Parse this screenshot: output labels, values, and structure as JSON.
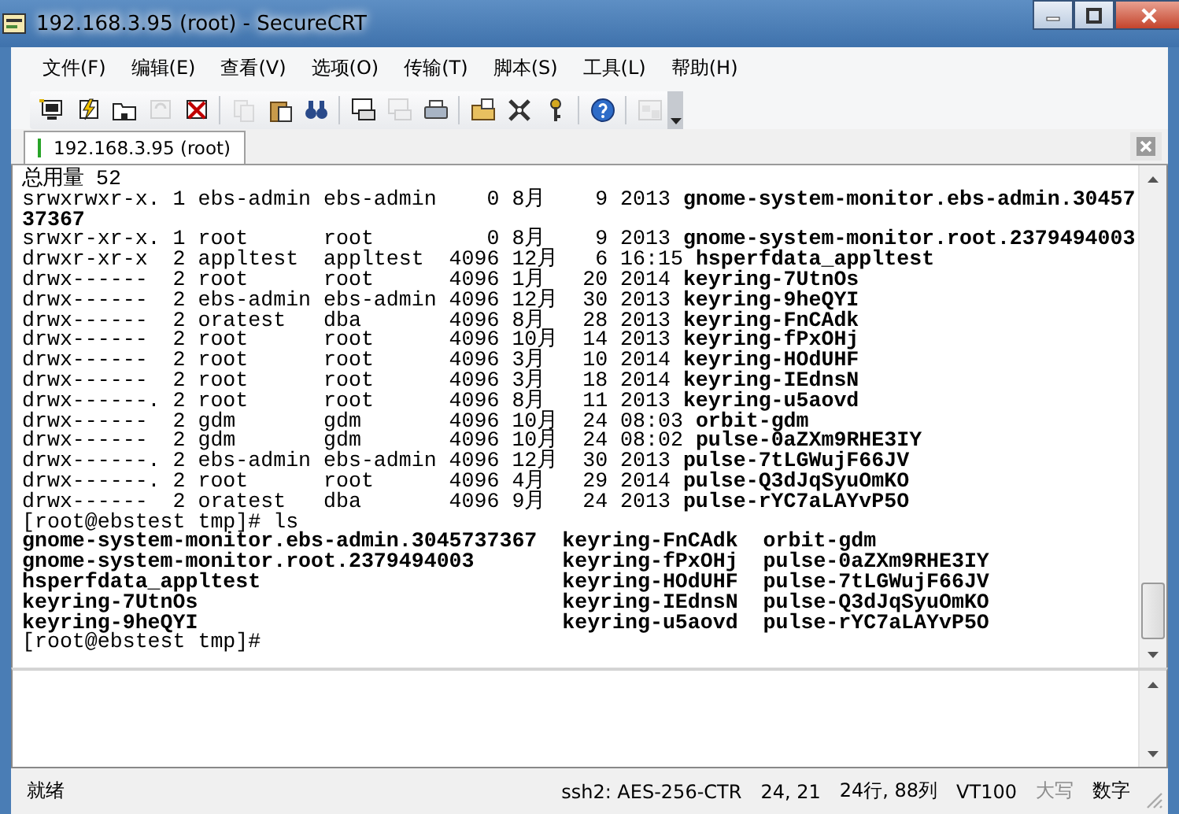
{
  "window": {
    "title": "192.168.3.95 (root) - SecureCRT"
  },
  "menu": [
    "文件(F)",
    "编辑(E)",
    "查看(V)",
    "选项(O)",
    "传输(T)",
    "脚本(S)",
    "工具(L)",
    "帮助(H)"
  ],
  "toolbar": [
    {
      "kind": "connect",
      "disabled": false
    },
    {
      "kind": "quick",
      "disabled": false
    },
    {
      "kind": "folder",
      "disabled": false
    },
    {
      "kind": "reconnect",
      "disabled": true
    },
    {
      "kind": "disconnect",
      "disabled": false
    },
    {
      "kind": "separator"
    },
    {
      "kind": "copy",
      "disabled": true
    },
    {
      "kind": "paste",
      "disabled": false
    },
    {
      "kind": "find",
      "disabled": false
    },
    {
      "kind": "separator"
    },
    {
      "kind": "printscreen",
      "disabled": false
    },
    {
      "kind": "printsel",
      "disabled": true
    },
    {
      "kind": "print",
      "disabled": false
    },
    {
      "kind": "separator"
    },
    {
      "kind": "options",
      "disabled": false
    },
    {
      "kind": "mapkeys",
      "disabled": false
    },
    {
      "kind": "key",
      "disabled": false
    },
    {
      "kind": "separator"
    },
    {
      "kind": "help",
      "disabled": false
    },
    {
      "kind": "separator"
    },
    {
      "kind": "window",
      "disabled": true
    }
  ],
  "tabs": [
    {
      "label": "192.168.3.95 (root)",
      "selected": true
    }
  ],
  "terminal": {
    "lines": [
      {
        "text": "总用量 52",
        "bold": false
      },
      {
        "text": "srwxrwxr-x. 1 ebs-admin ebs-admin    0 8月    9 2013 **gnome-system-monitor.ebs-admin.30457**",
        "bold": false
      },
      {
        "text": "37367",
        "bold": true
      },
      {
        "text": "srwxr-xr-x. 1 root      root         0 8月    9 2013 **gnome-system-monitor.root.2379494003**",
        "bold": false
      },
      {
        "text": "drwxr-xr-x  2 appltest  appltest  4096 12月   6 16:15 **hsperfdata_appltest**",
        "bold": false
      },
      {
        "text": "drwx------  2 root      root      4096 1月   20 2014 **keyring-7UtnOs**",
        "bold": false
      },
      {
        "text": "drwx------  2 ebs-admin ebs-admin 4096 12月  30 2013 **keyring-9heQYI**",
        "bold": false
      },
      {
        "text": "drwx------  2 oratest   dba       4096 8月   28 2013 **keyring-FnCAdk**",
        "bold": false
      },
      {
        "text": "drwx------  2 root      root      4096 10月  14 2013 **keyring-fPxOHj**",
        "bold": false
      },
      {
        "text": "drwx------  2 root      root      4096 3月   10 2014 **keyring-HOdUHF**",
        "bold": false
      },
      {
        "text": "drwx------  2 root      root      4096 3月   18 2014 **keyring-IEdnsN**",
        "bold": false
      },
      {
        "text": "drwx------. 2 root      root      4096 8月   11 2013 **keyring-u5aovd**",
        "bold": false
      },
      {
        "text": "drwx------  2 gdm       gdm       4096 10月  24 08:03 **orbit-gdm**",
        "bold": false
      },
      {
        "text": "drwx------  2 gdm       gdm       4096 10月  24 08:02 **pulse-0aZXm9RHE3IY**",
        "bold": false
      },
      {
        "text": "drwx------. 2 ebs-admin ebs-admin 4096 12月  30 2013 **pulse-7tLGWujF66JV**",
        "bold": false
      },
      {
        "text": "drwx------. 2 root      root      4096 4月   29 2014 **pulse-Q3dJqSyuOmKO**",
        "bold": false
      },
      {
        "text": "drwx------  2 oratest   dba       4096 9月   24 2013 **pulse-rYC7aLAYvP5O**",
        "bold": false
      },
      {
        "text": "[root@ebstest tmp]# ls",
        "bold": false
      },
      {
        "text": "gnome-system-monitor.ebs-admin.3045737367  keyring-FnCAdk  orbit-gdm",
        "bold": true
      },
      {
        "text": "gnome-system-monitor.root.2379494003       keyring-fPxOHj  pulse-0aZXm9RHE3IY",
        "bold": true
      },
      {
        "text": "hsperfdata_appltest                        keyring-HOdUHF  pulse-7tLGWujF66JV",
        "bold": true
      },
      {
        "text": "keyring-7UtnOs                             keyring-IEdnsN  pulse-Q3dJqSyuOmKO",
        "bold": true
      },
      {
        "text": "keyring-9heQYI                             keyring-u5aovd  pulse-rYC7aLAYvP5O",
        "bold": true
      },
      {
        "text": "[root@ebstest tmp]#",
        "bold": false
      }
    ]
  },
  "status_bar": [
    {
      "text": "就绪",
      "disabled": false
    },
    {
      "text": "ssh2: AES-256-CTR",
      "disabled": false
    },
    {
      "text": "24,  21",
      "disabled": false
    },
    {
      "text": "24行, 88列",
      "disabled": false
    },
    {
      "text": "VT100",
      "disabled": false
    },
    {
      "text": "大写",
      "disabled": true
    },
    {
      "text": "数字",
      "disabled": false
    }
  ]
}
